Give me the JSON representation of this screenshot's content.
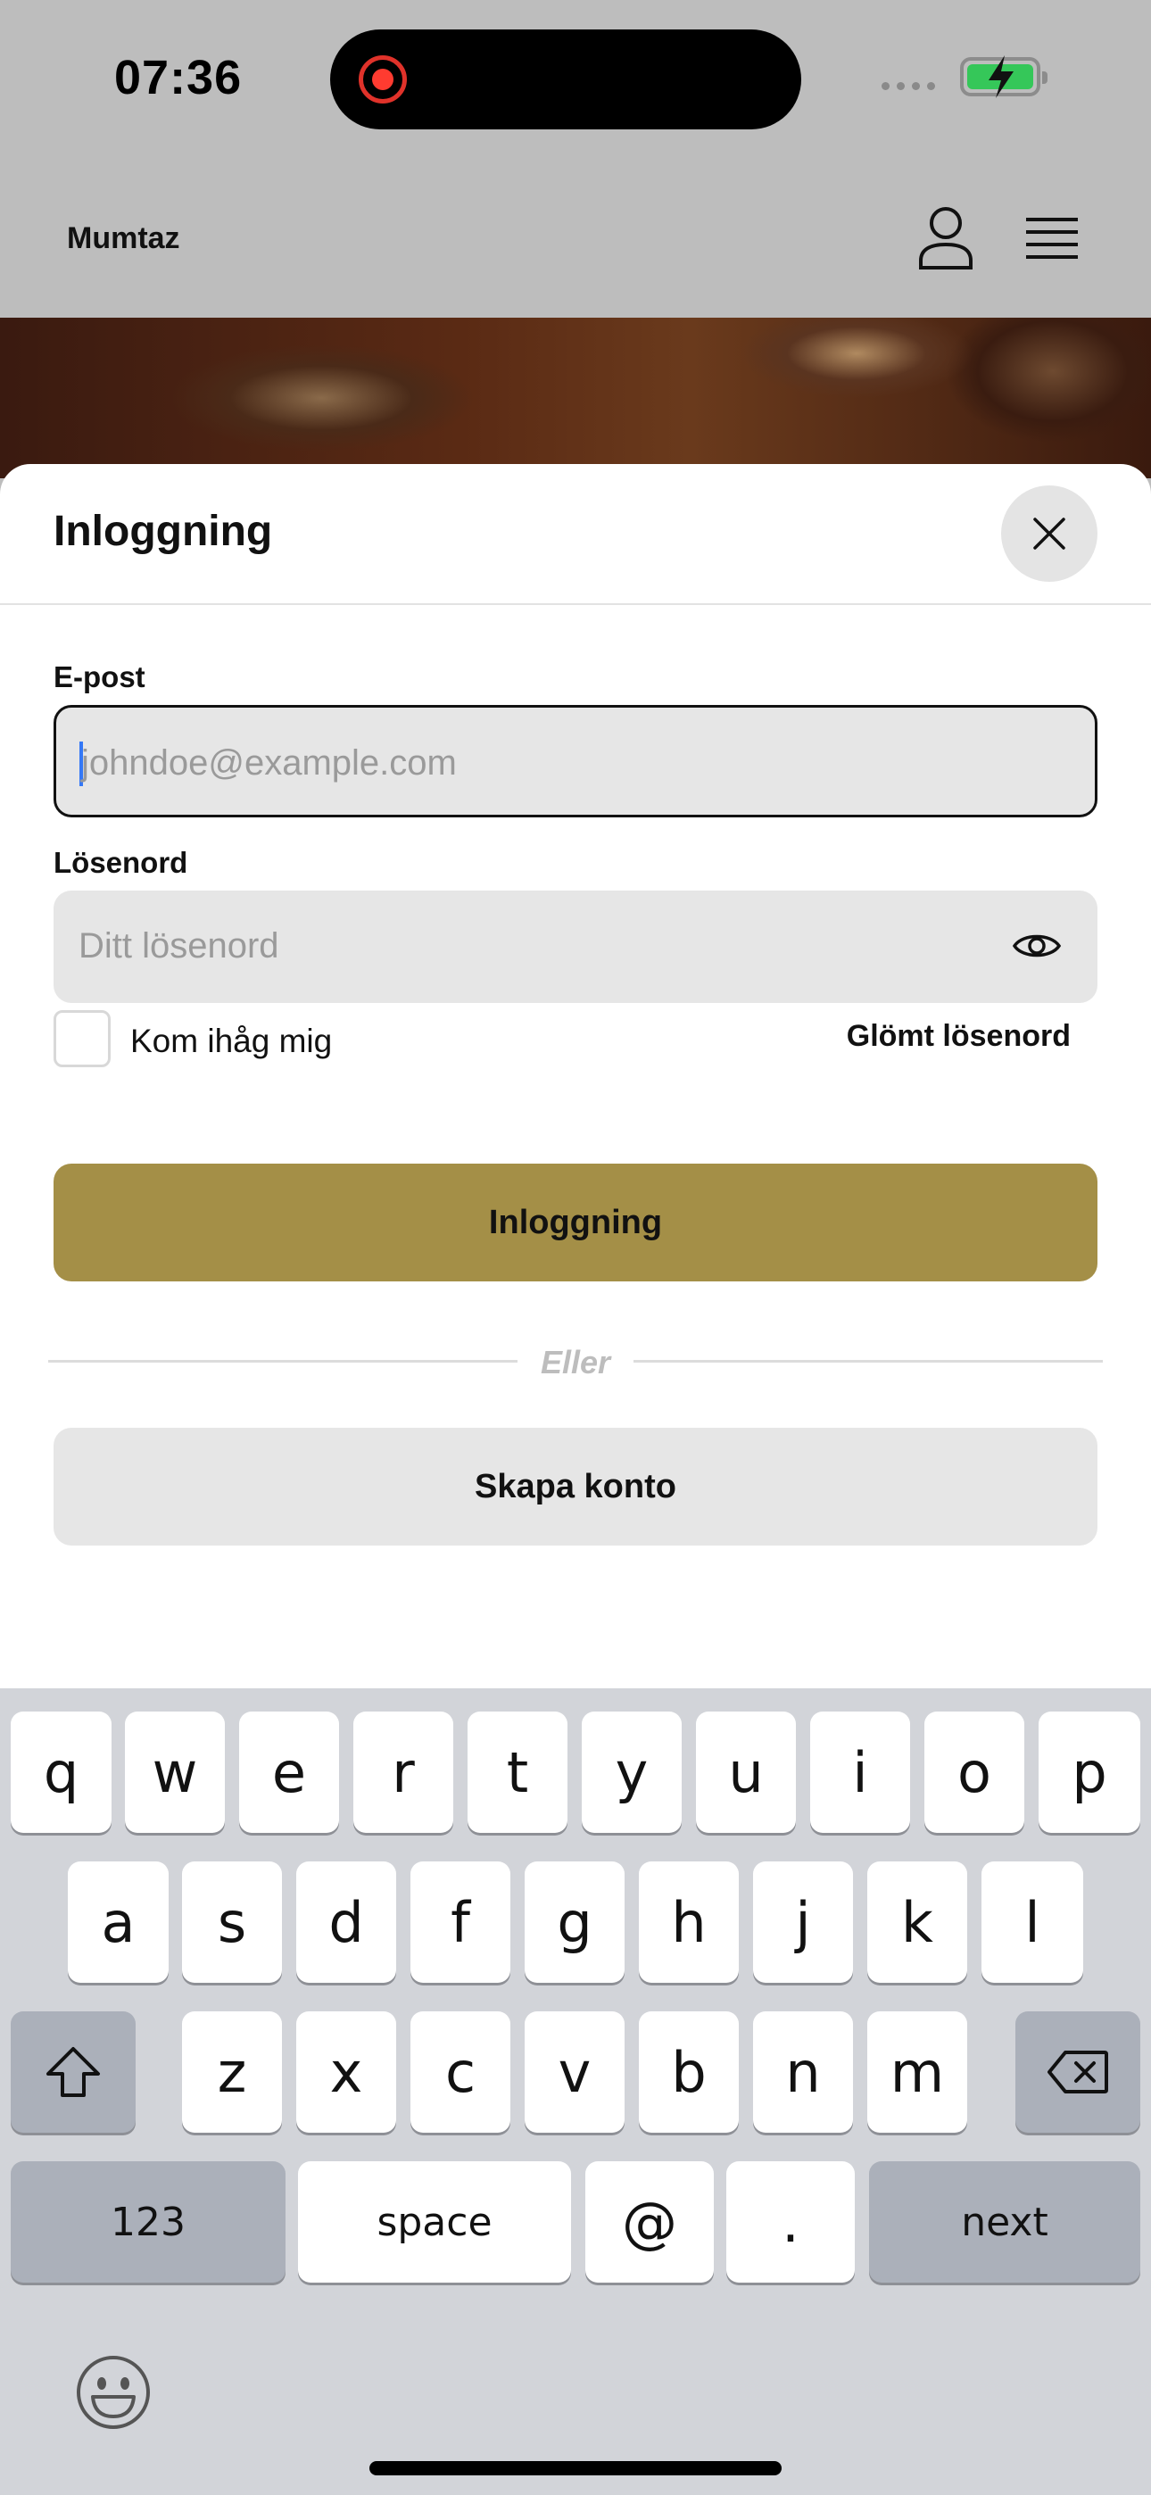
{
  "status_bar": {
    "time": "07:36"
  },
  "header": {
    "brand": "Mumtaz"
  },
  "sheet": {
    "title": "Inloggning",
    "email": {
      "label": "E-post",
      "placeholder": "johndoe@example.com"
    },
    "password": {
      "label": "Lösenord",
      "placeholder": "Ditt lösenord"
    },
    "remember_label": "Kom ihåg mig",
    "forgot_label": "Glömt lösenord",
    "login_button": "Inloggning",
    "divider_text": "Eller",
    "create_button": "Skapa konto",
    "accent_color": "#a48f47"
  },
  "keyboard": {
    "row1": [
      "q",
      "w",
      "e",
      "r",
      "t",
      "y",
      "u",
      "i",
      "o",
      "p"
    ],
    "row2": [
      "a",
      "s",
      "d",
      "f",
      "g",
      "h",
      "j",
      "k",
      "l"
    ],
    "row3": [
      "z",
      "x",
      "c",
      "v",
      "b",
      "n",
      "m"
    ],
    "numbers_key": "123",
    "space_key": "space",
    "at_key": "@",
    "dot_key": ".",
    "next_key": "next"
  },
  "icons": [
    "record-icon",
    "battery-icon",
    "user-icon",
    "menu-icon",
    "close-icon",
    "eye-icon",
    "shift-icon",
    "backspace-icon",
    "emoji-icon"
  ]
}
